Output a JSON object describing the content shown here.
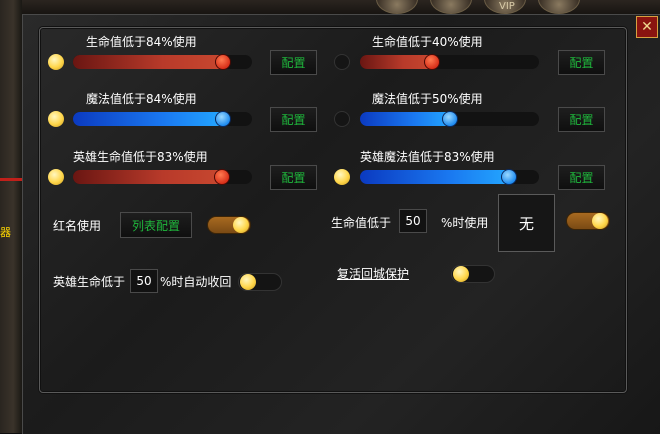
{
  "background": {
    "side_label": "器",
    "top_disc_text": "VIP"
  },
  "close": {
    "icon": "close-icon",
    "symbol": "✕",
    "color": "#8a1410"
  },
  "colors": {
    "config_text": "#1fb83c",
    "red_bar": "#c7472f",
    "blue_bar": "#1a78f0",
    "toggle_on": "#a86a20",
    "indicator": "#ffd64a"
  },
  "sliders": [
    {
      "label": "生命值低于84%使用",
      "value": 84,
      "color": "red",
      "indicator_on": true,
      "config_label": "配置"
    },
    {
      "label": "生命值低于40%使用",
      "value": 40,
      "color": "red",
      "indicator_on": false,
      "config_label": "配置"
    },
    {
      "label": "魔法值低于84%使用",
      "value": 84,
      "color": "blue",
      "indicator_on": true,
      "config_label": "配置"
    },
    {
      "label": "魔法值低于50%使用",
      "value": 50,
      "color": "blue",
      "indicator_on": false,
      "config_label": "配置"
    },
    {
      "label": "英雄生命值低于83%使用",
      "value": 83,
      "color": "red",
      "indicator_on": true,
      "config_label": "配置"
    },
    {
      "label": "英雄魔法值低于83%使用",
      "value": 83,
      "color": "blue",
      "indicator_on": true,
      "config_label": "配置"
    }
  ],
  "red_name": {
    "label": "红名使用",
    "button": "列表配置",
    "enabled": true
  },
  "low_hp": {
    "prefix": "生命值低于",
    "value": "50",
    "suffix": "%时使用",
    "item": "无",
    "enabled": true
  },
  "hero_recall": {
    "prefix": "英雄生命低于",
    "value": "50",
    "suffix": "%时自动收回",
    "enabled": false
  },
  "revive_protect": {
    "label": "复活回城保护",
    "enabled": false
  }
}
